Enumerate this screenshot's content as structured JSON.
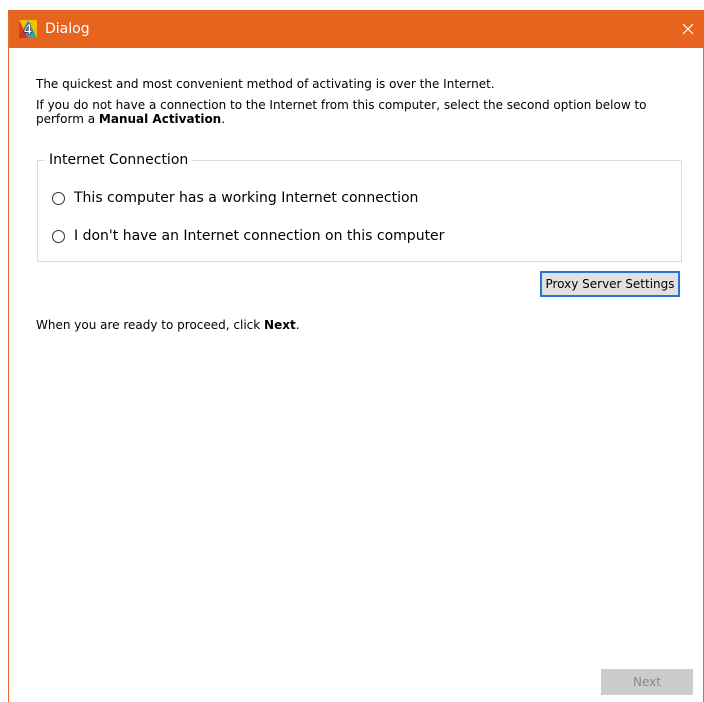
{
  "window": {
    "title": "Dialog",
    "accent_color": "#e7641f",
    "app_icon": "4d-app-icon",
    "close_icon": "close-icon"
  },
  "intro": {
    "line1": "The quickest and most convenient method of activating is over the Internet.",
    "line2": "If you do not have a connection to the Internet from this computer, select the second option below to",
    "line3_prefix": "perform a ",
    "line3_bold": "Manual Activation",
    "line3_suffix": "."
  },
  "internet_group": {
    "legend": "Internet Connection",
    "options": [
      {
        "label": "This computer has a working Internet connection",
        "selected": false
      },
      {
        "label": "I don't have an Internet connection on this computer",
        "selected": false
      }
    ]
  },
  "proxy_button": {
    "label": "Proxy Server Settings"
  },
  "proceed": {
    "prefix": "When you are ready to proceed, click ",
    "bold": "Next",
    "suffix": "."
  },
  "next_button": {
    "label": "Next",
    "enabled": false
  }
}
